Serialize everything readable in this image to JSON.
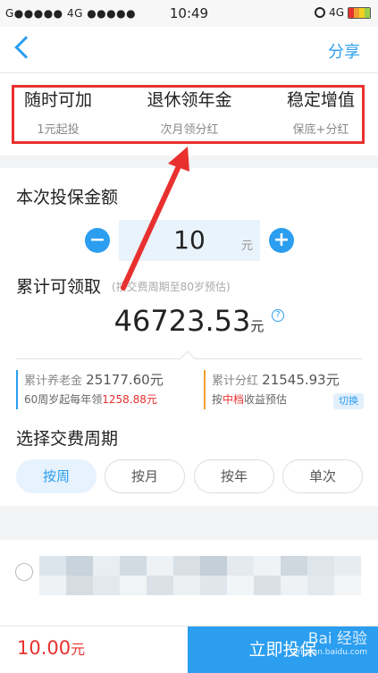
{
  "status": {
    "carrier": "G●●●●● 4G ●●●●●",
    "time": "10:49",
    "network": "4G"
  },
  "nav": {
    "back_icon": "chevron-left-icon",
    "share_label": "分享"
  },
  "features": [
    {
      "title": "随时可加",
      "sub": "1元起投"
    },
    {
      "title": "退休领年金",
      "sub": "次月领分红"
    },
    {
      "title": "稳定增值",
      "sub": "保底+分红"
    }
  ],
  "invest": {
    "title": "本次投保金额",
    "amount": "10",
    "unit": "元",
    "minus": "−",
    "plus": "+"
  },
  "total": {
    "label": "累计可领取",
    "note": "(按交费周期至80岁预估)",
    "value": "46723.53",
    "unit": "元",
    "help": "?"
  },
  "pension": {
    "label": "累计养老金",
    "value": "25177.60元",
    "line2_prefix": "60周岁起每年领",
    "line2_value": "1258.88元"
  },
  "dividend": {
    "label": "累计分红",
    "value": "21545.93元",
    "line2_prefix": "按",
    "line2_highlight": "中档",
    "line2_suffix": "收益预估",
    "switch_label": "切换"
  },
  "period": {
    "title": "选择交费周期",
    "options": [
      "按周",
      "按月",
      "按年",
      "单次"
    ],
    "selected": "按周"
  },
  "bottom": {
    "price": "10.00",
    "price_unit": "元",
    "buy_label": "立即投保",
    "watermark": "Bai 经验",
    "watermark_url": "jingyan.baidu.com"
  },
  "colors": {
    "accent": "#2b9ef0",
    "highlight_red": "#e8312f",
    "pension_bar": "#2b9ef0",
    "dividend_bar": "#f0a030"
  }
}
